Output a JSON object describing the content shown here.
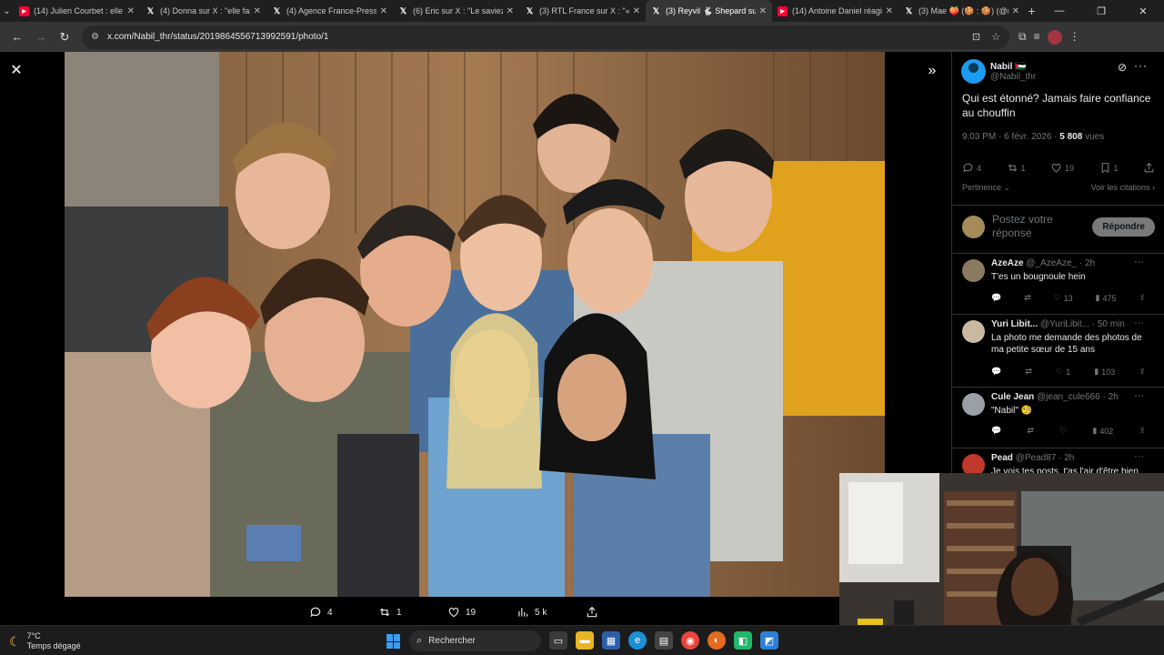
{
  "tabs": [
    {
      "label": "(14) Julien Courbet : elle a",
      "favicon": "youtube-icon",
      "active": false
    },
    {
      "label": "(4) Donna sur X : \"elle fait",
      "favicon": "x-logo-icon",
      "active": false
    },
    {
      "label": "(4) Agence France-Presse",
      "favicon": "x-logo-icon",
      "active": false
    },
    {
      "label": "(6) Eric sur X : \"Le saviez",
      "favicon": "x-logo-icon",
      "active": false
    },
    {
      "label": "(3) RTL France sur X : \"« Le",
      "favicon": "x-logo-icon",
      "active": false
    },
    {
      "label": "(3) Reyvil 🐇 Shepard sur X",
      "favicon": "x-logo-icon",
      "active": true
    },
    {
      "label": "(14) Antoine Daniel réagit",
      "favicon": "youtube-icon",
      "active": false
    },
    {
      "label": "(3) Mae 🍑 (🍪 : 🍪) (@m",
      "favicon": "x-logo-icon",
      "active": false
    }
  ],
  "address": {
    "url": "x.com/Nabil_thr/status/2019864556713992591/photo/1"
  },
  "actions": {
    "replies": "4",
    "reposts": "1",
    "likes": "19",
    "views": "5 k"
  },
  "tweet": {
    "author_name": "Nabil 🇵🇸",
    "author_handle": "@Nabil_thr",
    "text": "Qui est étonné? Jamais faire confiance au chouffin",
    "time": "9:03 PM · 6 févr. 2026 · ",
    "views_count": "5 808",
    "views_label": " vues",
    "stat_replies": "4",
    "stat_reposts": "1",
    "stat_likes": "19",
    "stat_bookmarks": "1",
    "sort_label": "Pertinence",
    "quotes_link": "Voir les citations ›",
    "reply_placeholder": "Postez votre réponse",
    "reply_button": "Répondre"
  },
  "replies": [
    {
      "name": "AzeAze",
      "handle": "@_AzeAze_ · 2h",
      "text": "T'es un bougnoule hein",
      "likes": "13",
      "views": "475",
      "reposts": "",
      "avatar_color": "#8a7a60"
    },
    {
      "name": "Yuri Libit...",
      "handle": "@YuriLibit... · 50 min",
      "text": "La photo me demande des photos de ma petite sœur de 15 ans",
      "likes": "1",
      "views": "103",
      "reposts": "",
      "avatar_color": "#c9b9a0"
    },
    {
      "name": "Cule Jean",
      "handle": "@jean_cule666 · 2h",
      "text": "\"Nabil\" 🧐",
      "likes": "",
      "views": "402",
      "reposts": "",
      "avatar_color": "#9aa0a6"
    },
    {
      "name": "Pead",
      "handle": "@Pead87 · 2h",
      "text": "Je vois tes posts, t'as l'air d'être bien",
      "likes": "",
      "views": "",
      "reposts": "",
      "avatar_color": "#c0392b"
    }
  ],
  "taskbar": {
    "temperature": "7°C",
    "weather": "Temps dégagé",
    "search_label": "Rechercher"
  },
  "colors": {
    "accent": "#1d9bf0",
    "background": "#000000"
  }
}
